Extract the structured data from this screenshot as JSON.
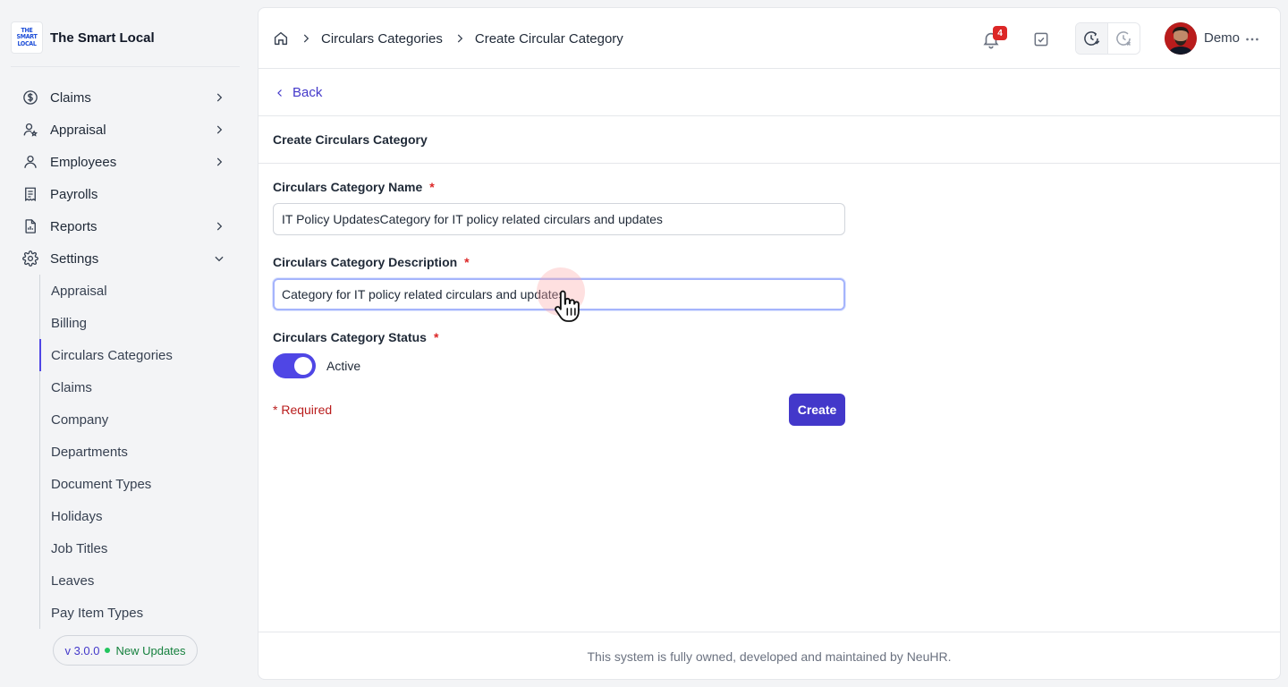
{
  "brand": {
    "logo_lines": [
      "THE",
      "SMART",
      "LOCAL"
    ],
    "name": "The Smart Local"
  },
  "sidebar": {
    "items": [
      {
        "label": "Claims",
        "icon": "dollar-circle-icon",
        "expandable": true
      },
      {
        "label": "Appraisal",
        "icon": "user-star-icon",
        "expandable": true
      },
      {
        "label": "Employees",
        "icon": "user-icon",
        "expandable": true
      },
      {
        "label": "Payrolls",
        "icon": "receipt-icon",
        "expandable": false
      },
      {
        "label": "Reports",
        "icon": "file-chart-icon",
        "expandable": true
      },
      {
        "label": "Settings",
        "icon": "gear-icon",
        "expandable": true,
        "expanded": true
      }
    ],
    "settings_sub": [
      "Appraisal",
      "Billing",
      "Circulars Categories",
      "Claims",
      "Company",
      "Departments",
      "Document Types",
      "Holidays",
      "Job Titles",
      "Leaves",
      "Pay Item Types"
    ],
    "active_sub": "Circulars Categories",
    "version": "v 3.0.0",
    "updates": "New Updates"
  },
  "header": {
    "breadcrumbs": [
      "Circulars Categories",
      "Create Circular Category"
    ],
    "notification_count": "4",
    "user_name": "Demo"
  },
  "page": {
    "back_label": "Back",
    "form_title": "Create Circulars Category",
    "name_label": "Circulars Category Name",
    "name_value": "IT Policy UpdatesCategory for IT policy related circulars and updates",
    "description_label": "Circulars Category Description",
    "description_value": "Category for IT policy related circulars and updates",
    "status_label": "Circulars Category Status",
    "status_text": "Active",
    "status_on": true,
    "required_star": "*",
    "required_note": "* Required",
    "create_label": "Create"
  },
  "footer": {
    "text": "This system is fully owned, developed and maintained by NeuHR."
  },
  "colors": {
    "accent": "#4338ca",
    "toggle_on": "#4f46e5",
    "danger": "#dc2626",
    "success": "#22c55e"
  }
}
